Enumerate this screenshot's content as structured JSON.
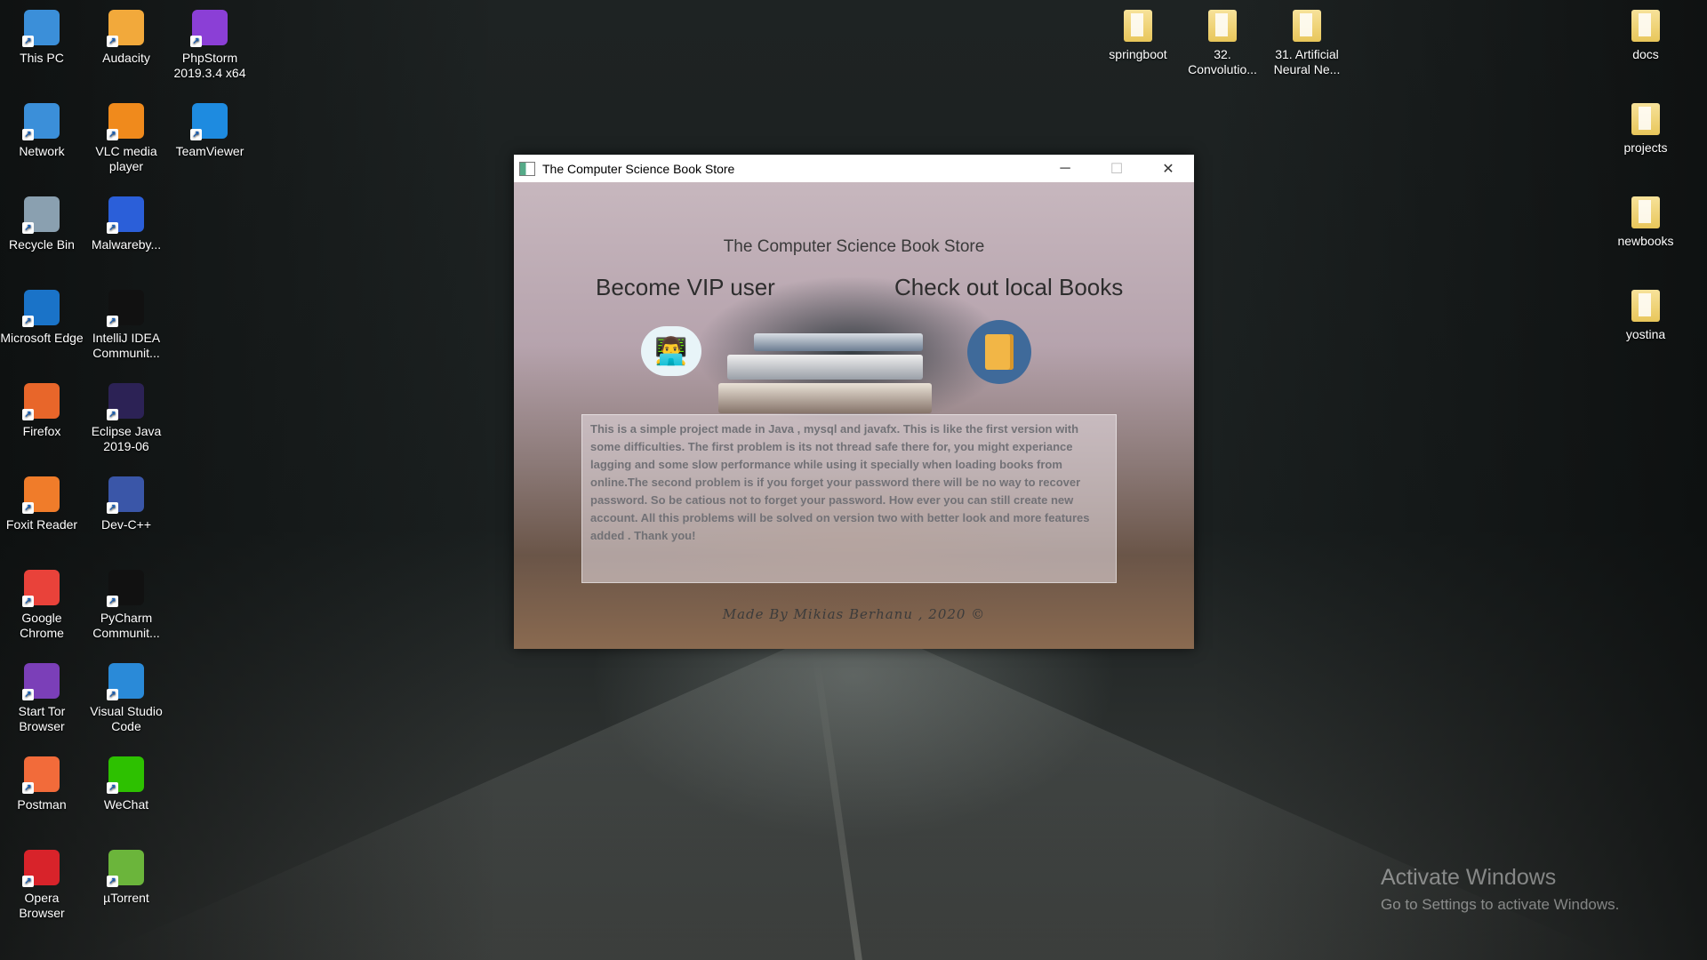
{
  "desktop": {
    "icons_left": [
      {
        "label": "This PC",
        "icon": "computer-icon",
        "color": "#3b8fd9"
      },
      {
        "label": "Network",
        "icon": "network-icon",
        "color": "#3b8fd9"
      },
      {
        "label": "Recycle Bin",
        "icon": "recycle-bin-icon",
        "color": "#8aa0b0"
      },
      {
        "label": "Microsoft Edge",
        "icon": "edge-icon",
        "color": "#1a73c8"
      },
      {
        "label": "Firefox",
        "icon": "firefox-icon",
        "color": "#e8662a"
      },
      {
        "label": "Foxit Reader",
        "icon": "foxit-icon",
        "color": "#f07c2a"
      },
      {
        "label": "Google Chrome",
        "icon": "chrome-icon",
        "color": "#e9423a"
      },
      {
        "label": "Start Tor Browser",
        "icon": "tor-icon",
        "color": "#7b3fb8"
      },
      {
        "label": "Postman",
        "icon": "postman-icon",
        "color": "#f26b3a"
      },
      {
        "label": "Opera Browser",
        "icon": "opera-icon",
        "color": "#d8232a"
      }
    ],
    "icons_second": [
      {
        "label": "Audacity",
        "icon": "audacity-icon",
        "color": "#f2a93b"
      },
      {
        "label": "VLC media player",
        "icon": "vlc-icon",
        "color": "#f08a1c"
      },
      {
        "label": "Malwareby...",
        "icon": "malwarebytes-icon",
        "color": "#2b5fd9"
      },
      {
        "label": "IntelliJ IDEA Communit...",
        "icon": "intellij-icon",
        "color": "#111111"
      },
      {
        "label": "Eclipse Java 2019-06",
        "icon": "eclipse-icon",
        "color": "#2c2255"
      },
      {
        "label": "Dev-C++",
        "icon": "devcpp-icon",
        "color": "#3a56a8"
      },
      {
        "label": "PyCharm Communit...",
        "icon": "pycharm-icon",
        "color": "#111111"
      },
      {
        "label": "Visual Studio Code",
        "icon": "vscode-icon",
        "color": "#2a8ad8"
      },
      {
        "label": "WeChat",
        "icon": "wechat-icon",
        "color": "#2dc100"
      },
      {
        "label": "µTorrent",
        "icon": "utorrent-icon",
        "color": "#6bb53b"
      }
    ],
    "icons_third": [
      {
        "label": "PhpStorm 2019.3.4 x64",
        "icon": "phpstorm-icon",
        "color": "#8b3fd6"
      },
      {
        "label": "TeamViewer",
        "icon": "teamviewer-icon",
        "color": "#1e8be0"
      }
    ],
    "icons_top_folders": [
      {
        "label": "springboot",
        "icon": "folder-icon"
      },
      {
        "label": "32. Convolutio...",
        "icon": "folder-icon"
      },
      {
        "label": "31. Artificial Neural Ne...",
        "icon": "folder-icon"
      }
    ],
    "icons_right": [
      {
        "label": "docs",
        "icon": "folder-icon"
      },
      {
        "label": "projects",
        "icon": "folder-icon"
      },
      {
        "label": "newbooks",
        "icon": "folder-icon"
      },
      {
        "label": "yostina",
        "icon": "folder-icon"
      }
    ],
    "watermark": {
      "title": "Activate Windows",
      "subtitle": "Go to Settings to activate Windows."
    }
  },
  "window": {
    "title": "The Computer Science Book Store",
    "controls": {
      "minimize": "─",
      "maximize": "☐",
      "close": "✕"
    },
    "heading": "The Computer Science Book Store",
    "vip_label": "Become VIP user",
    "local_label": "Check out local Books",
    "description": "This is a simple project made in Java , mysql and javafx.  This is like the first version with some difficulties. The first problem is its not thread safe there for, you might experiance lagging and some slow performance while using it specially when loading books from online.The second problem is if you forget your password there will be no way to recover password. So be catious not to forget your password. How ever you can still create new account. All this problems will be solved on version two with better look and more features added . Thank you!",
    "credit": "Made By Mikias Berhanu , 2020 ©"
  }
}
